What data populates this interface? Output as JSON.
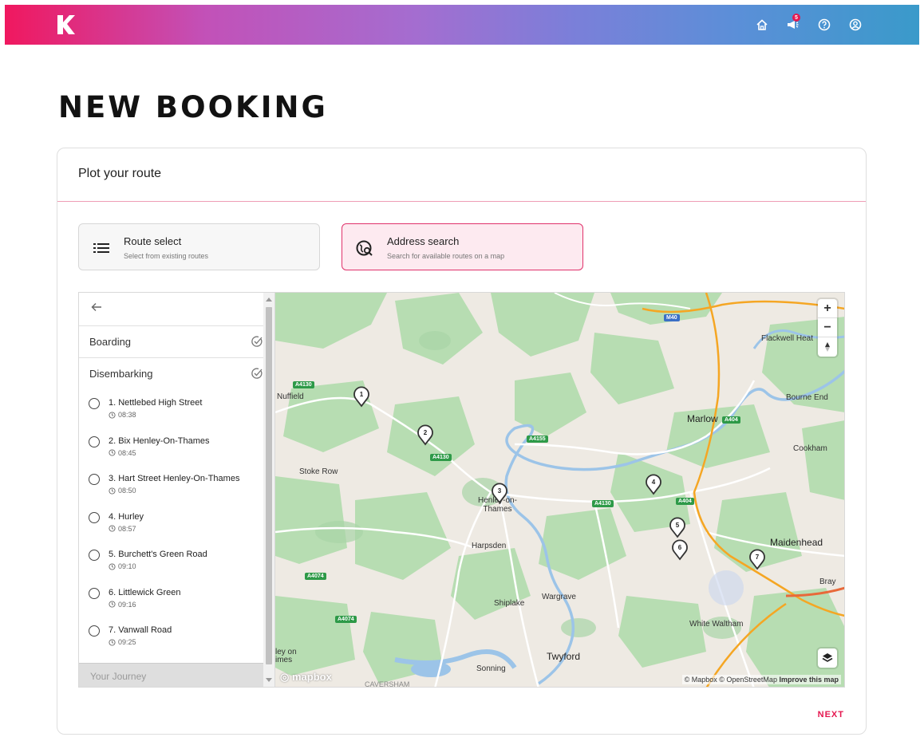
{
  "header": {
    "notification_count": "5",
    "icons": [
      "home-icon",
      "megaphone-icon",
      "help-icon",
      "account-icon"
    ]
  },
  "page": {
    "title": "NEW BOOKING"
  },
  "card": {
    "title": "Plot your route",
    "options": [
      {
        "title": "Route select",
        "subtitle": "Select from existing routes",
        "icon": "list-icon",
        "active": false
      },
      {
        "title": "Address search",
        "subtitle": "Search for available routes on a map",
        "icon": "map-search-icon",
        "active": true
      }
    ],
    "next_label": "NEXT"
  },
  "panel": {
    "boarding_label": "Boarding",
    "disembarking_label": "Disembarking",
    "stops": [
      {
        "name": "1. Nettlebed High Street",
        "time": "08:38"
      },
      {
        "name": "2. Bix Henley-On-Thames",
        "time": "08:45"
      },
      {
        "name": "3. Hart Street Henley-On-Thames",
        "time": "08:50"
      },
      {
        "name": "4. Hurley",
        "time": "08:57"
      },
      {
        "name": "5. Burchett's Green Road",
        "time": "09:10"
      },
      {
        "name": "6. Littlewick Green",
        "time": "09:16"
      },
      {
        "name": "7. Vanwall Road",
        "time": "09:25"
      }
    ],
    "journey_label": "Your Journey"
  },
  "map": {
    "places": {
      "nuffield": "Nuffield",
      "stoke_row": "Stoke Row",
      "henley": "Henley-on-\nThames",
      "harpsden": "Harpsden",
      "shiplake": "Shiplake",
      "wargrave": "Wargrave",
      "twyford": "Twyford",
      "sonning": "Sonning",
      "caversham": "CAVERSHAM",
      "marlow": "Marlow",
      "bourne_end": "Bourne End",
      "cookham": "Cookham",
      "flackwell": "Flackwell Heat",
      "maidenhead": "Maidenhead",
      "bray": "Bray",
      "white_waltham": "White Waltham",
      "edge": "ley on\nimes"
    },
    "roads": {
      "a4130a": "A4130",
      "a4130b": "A4130",
      "a4130c": "A4130",
      "a4155": "A4155",
      "a404a": "A404",
      "a404b": "A404",
      "a4074a": "A4074",
      "a4074b": "A4074",
      "m40": "M40"
    },
    "pins": [
      "1",
      "2",
      "3",
      "4",
      "5",
      "6",
      "7"
    ],
    "zoom_in": "+",
    "zoom_out": "−",
    "attribution_main": "© Mapbox © OpenStreetMap",
    "attribution_link": "Improve this map",
    "logo_text": "mapbox",
    "colors": {
      "water": "#9cc4e8",
      "green": "#b7ddb2",
      "base": "#eeeae3",
      "motorway": "#f5a623"
    }
  }
}
